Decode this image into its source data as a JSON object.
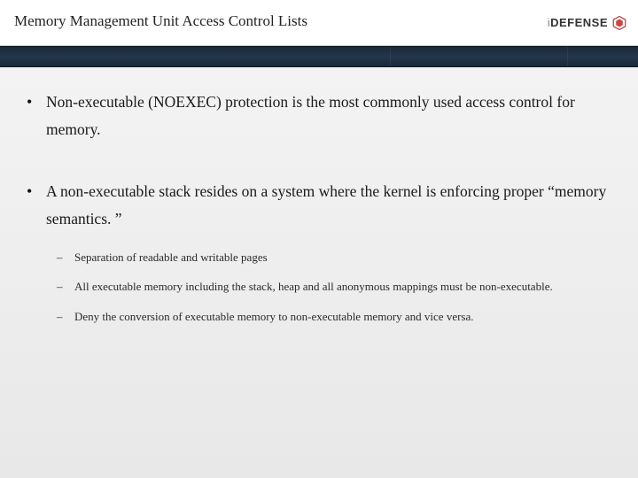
{
  "header": {
    "title": "Memory Management Unit Access Control Lists",
    "logo": {
      "brand_prefix": "i",
      "brand_main": "DEFENSE"
    }
  },
  "bullets": [
    {
      "text": "Non-executable (NOEXEC) protection is the most commonly used access control for memory.",
      "sub": []
    },
    {
      "text": "A non-executable stack resides on a system where the kernel is enforcing proper “memory semantics. ”",
      "sub": [
        "Separation of readable and writable pages",
        "All executable memory including the stack, heap and all anonymous mappings must be non-executable.",
        "Deny the conversion of executable memory to non-executable memory and vice versa."
      ]
    }
  ]
}
